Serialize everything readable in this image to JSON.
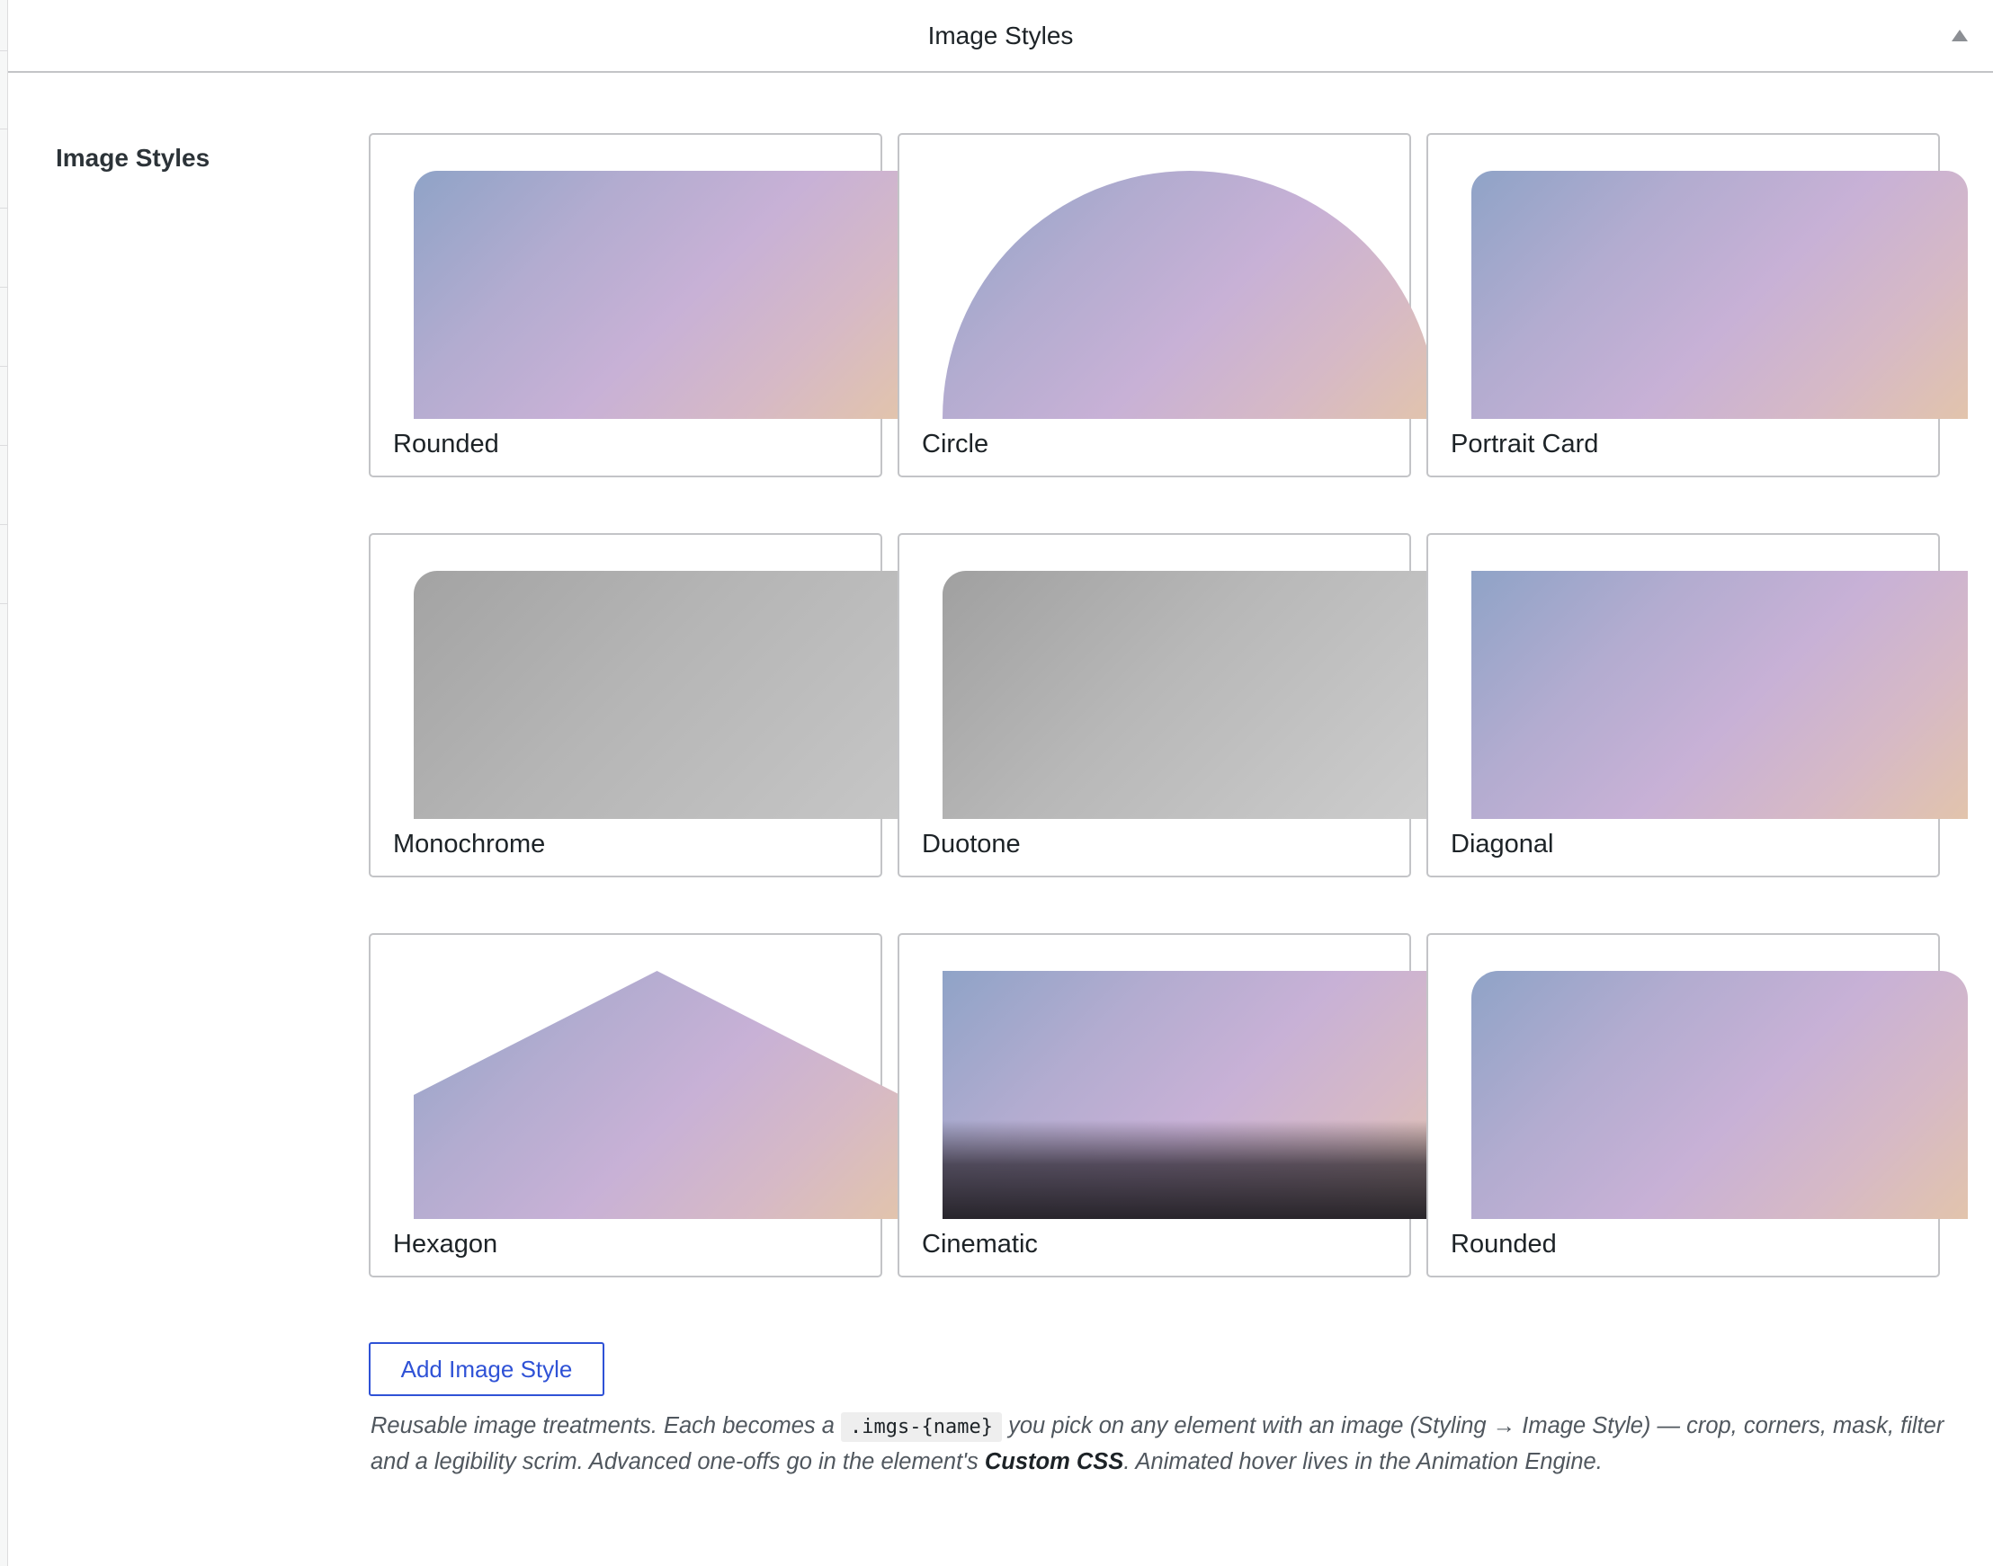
{
  "panel": {
    "title": "Image Styles"
  },
  "section": {
    "label": "Image Styles"
  },
  "styles": [
    {
      "name": "Rounded"
    },
    {
      "name": "Circle"
    },
    {
      "name": "Portrait Card"
    },
    {
      "name": "Monochrome"
    },
    {
      "name": "Duotone"
    },
    {
      "name": "Diagonal"
    },
    {
      "name": "Hexagon"
    },
    {
      "name": "Cinematic"
    },
    {
      "name": "Rounded"
    }
  ],
  "add_button": {
    "label": "Add Image Style"
  },
  "description": {
    "part1": "Reusable image treatments. Each becomes a ",
    "code": ".imgs-{name}",
    "part2": " you pick on any element with an image (Styling → Image Style) — crop, corners, mask, filter and a legibility scrim. Advanced one-offs go in the element's ",
    "bold": "Custom CSS",
    "part3": ". Animated hover lives in the Animation Engine."
  },
  "colors": {
    "accent": "#2f52d6",
    "border": "#c3c4c7"
  }
}
